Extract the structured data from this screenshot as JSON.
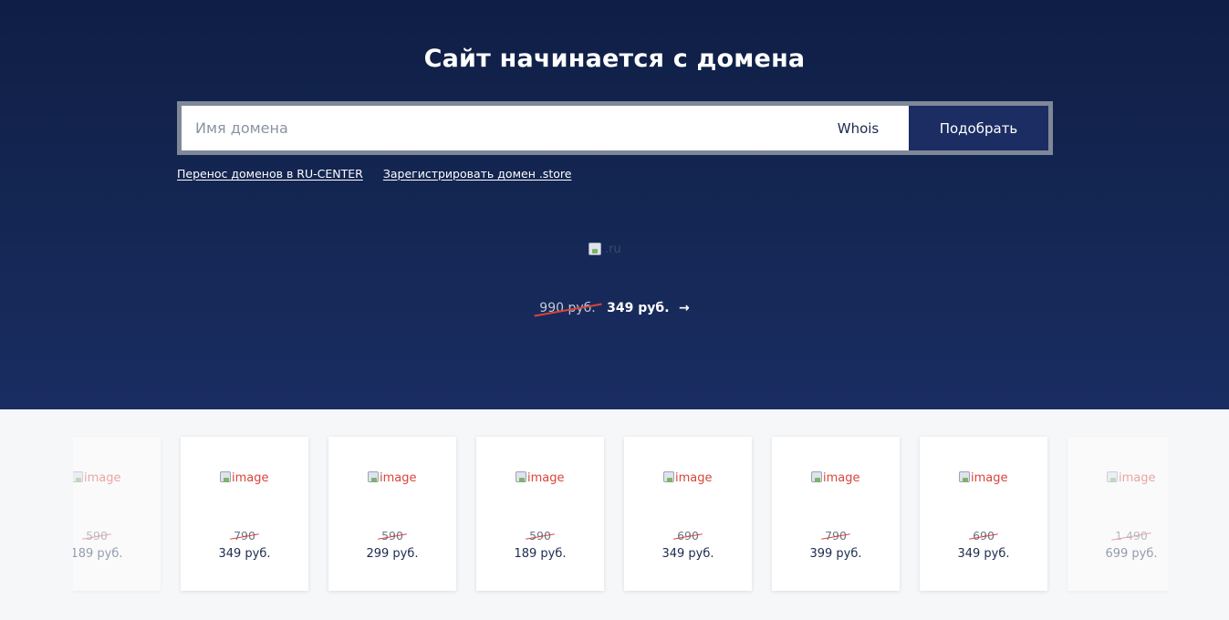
{
  "hero": {
    "title": "Сайт начинается с домена",
    "search_placeholder": "Имя домена",
    "whois_label": "Whois",
    "pick_button_label": "Подобрать",
    "links": [
      "Перенос доменов в RU-CENTER",
      "Зарегистрировать домен .store"
    ],
    "promo": {
      "image_alt": ".ru",
      "old_price": "990 руб.",
      "new_price": "349 руб.",
      "arrow": "→"
    }
  },
  "cards": [
    {
      "image_alt": "image",
      "old_price": "590",
      "new_price": "189 руб."
    },
    {
      "image_alt": "image",
      "old_price": "790",
      "new_price": "349 руб."
    },
    {
      "image_alt": "image",
      "old_price": "590",
      "new_price": "299 руб."
    },
    {
      "image_alt": "image",
      "old_price": "590",
      "new_price": "189 руб."
    },
    {
      "image_alt": "image",
      "old_price": "690",
      "new_price": "349 руб."
    },
    {
      "image_alt": "image",
      "old_price": "790",
      "new_price": "399 руб."
    },
    {
      "image_alt": "image",
      "old_price": "690",
      "new_price": "349 руб."
    },
    {
      "image_alt": "image",
      "old_price": "1 490",
      "new_price": "699 руб."
    }
  ],
  "colors": {
    "hero_bg": "#142754",
    "button_bg": "#1b2d62",
    "strike": "#d9443a",
    "card_text": "#1b2a4e"
  }
}
